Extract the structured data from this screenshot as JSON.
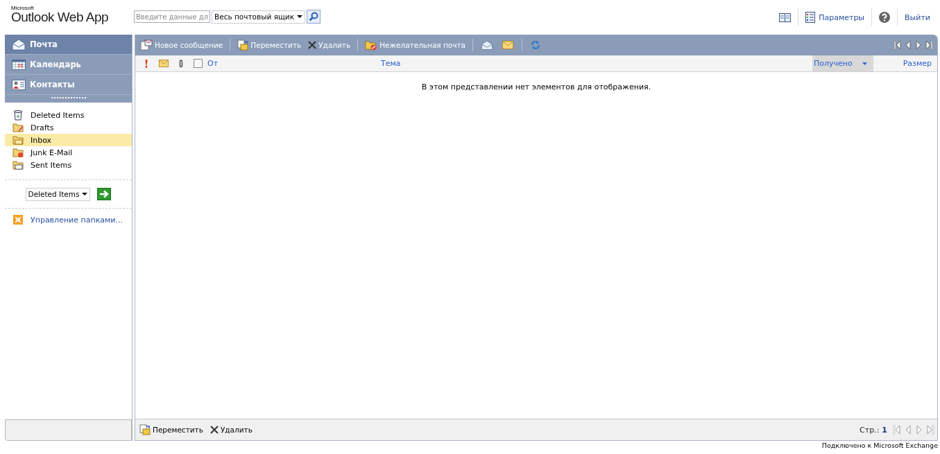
{
  "header": {
    "brand_small": "Microsoft",
    "brand": "Outlook Web App",
    "search": {
      "placeholder": "Введите данные дл"
    },
    "scope": "Весь почтовый ящик",
    "links": [
      {
        "kind": "icon"
      },
      {
        "kind": "labeled",
        "label": "Параметры"
      },
      {
        "kind": "icon"
      },
      {
        "kind": "text",
        "label": "Выйти"
      }
    ]
  },
  "modules": [
    {
      "label": "Почта",
      "selected": true
    },
    {
      "label": "Календарь",
      "selected": false
    },
    {
      "label": "Контакты",
      "selected": false
    }
  ],
  "folders": [
    {
      "label": "Deleted Items",
      "selected": false
    },
    {
      "label": "Drafts",
      "selected": false
    },
    {
      "label": "Inbox",
      "selected": true
    },
    {
      "label": "Junk E-Mail",
      "selected": false
    },
    {
      "label": "Sent Items",
      "selected": false
    }
  ],
  "move_to": {
    "value": "Deleted Items"
  },
  "manage_folders": "Управление папками...",
  "toolbar": [
    {
      "kind": "button",
      "label": "Новое сообщение"
    },
    {
      "kind": "sep"
    },
    {
      "kind": "button",
      "label": "Переместить"
    },
    {
      "kind": "button",
      "label": "Удалить"
    },
    {
      "kind": "sep"
    },
    {
      "kind": "button",
      "label": "Нежелательная почта"
    },
    {
      "kind": "sep"
    },
    {
      "kind": "icon"
    },
    {
      "kind": "icon"
    },
    {
      "kind": "sep"
    },
    {
      "kind": "icon"
    }
  ],
  "columns": [
    {
      "kind": "icon"
    },
    {
      "kind": "icon"
    },
    {
      "kind": "icon"
    },
    {
      "kind": "check",
      "checked": false
    },
    {
      "kind": "text",
      "label": "От",
      "sorted": false
    },
    {
      "kind": "text",
      "label": "Тема",
      "sorted": false
    },
    {
      "kind": "text",
      "label": "Получено",
      "sorted": true
    },
    {
      "kind": "text",
      "label": "Размер",
      "sorted": false
    }
  ],
  "empty_message": "В этом представлении нет элементов для отображения.",
  "bottom_toolbar": [
    {
      "label": "Переместить"
    },
    {
      "label": "Удалить"
    }
  ],
  "pager": {
    "label": "Стр.:",
    "page": "1"
  },
  "status": "Подключено к Microsoft Exchange"
}
